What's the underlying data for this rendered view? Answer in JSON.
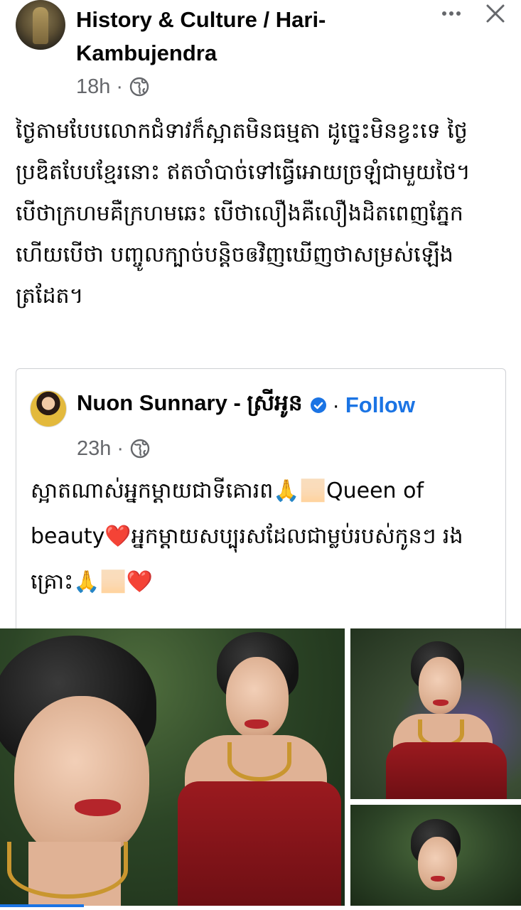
{
  "post": {
    "page_name": "History & Culture / Hari-Kambujendra",
    "time": "18h",
    "separator": "·",
    "text": "ថ្ងៃតាមបែបលោកជំទាវក៏ស្អាតមិនធម្មតា ដូច្នេះមិនខ្វះទេ ថ្ងៃប្រឌិតបែបខ្មែរនោះ ឥតចាំបាច់ទៅធ្វើអោយច្រឡំជាមួយថៃ។ បើថាក្រហមគឺក្រហមឆេះ បើថាលឿងគឺលឿងដិតពេញភ្នែក ហើយបើថា បញ្ចូលក្បាច់បន្តិចឲវិញឃើញថាសម្រស់ឡើងត្រដែត។"
  },
  "shared": {
    "author": "Nuon Sunnary - ស្រីអូន",
    "follow_separator": "·",
    "follow_label": "Follow",
    "time": "23h",
    "separator": "·",
    "text": "ស្អាតណាស់អ្នកម្ដាយជាទីគោរព🙏🏻Queen of beauty❤️អ្នកម្ដាយសប្បុរសដែលជាម្លប់របស់កូនៗ រងគ្រោះ🙏🏻❤️"
  },
  "colors": {
    "text_primary": "#050505",
    "text_secondary": "#65676b",
    "link": "#1b74e4",
    "border": "#ced0d4",
    "dress_red": "#9b1a1f"
  },
  "icons": {
    "more": "more-horizontal-icon",
    "close": "close-icon",
    "privacy": "globe-icon",
    "verified": "verified-badge-icon"
  },
  "photos": [
    {
      "name": "photo-large"
    },
    {
      "name": "photo-top-right"
    },
    {
      "name": "photo-bottom-right"
    }
  ]
}
